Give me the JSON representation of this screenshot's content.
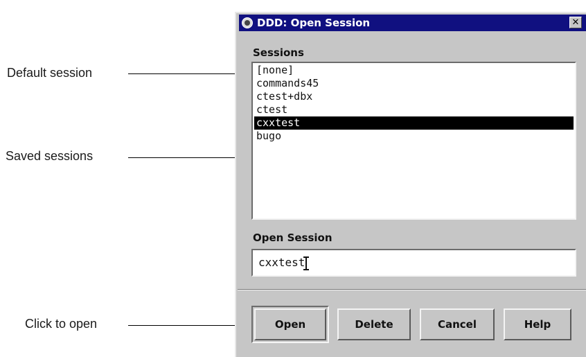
{
  "annotations": {
    "default_session": "Default session",
    "saved_sessions": "Saved sessions",
    "click_to_open": "Click to open"
  },
  "dialog": {
    "title": "DDD: Open Session",
    "close_glyph": "✕",
    "sessions_label": "Sessions",
    "sessions": [
      "[none]",
      "commands45",
      "ctest+dbx",
      "ctest",
      "cxxtest",
      "bugo"
    ],
    "selected_session": "cxxtest",
    "open_session_label": "Open Session",
    "open_session_value": "cxxtest",
    "buttons": {
      "open": "Open",
      "delete": "Delete",
      "cancel": "Cancel",
      "help": "Help"
    }
  }
}
